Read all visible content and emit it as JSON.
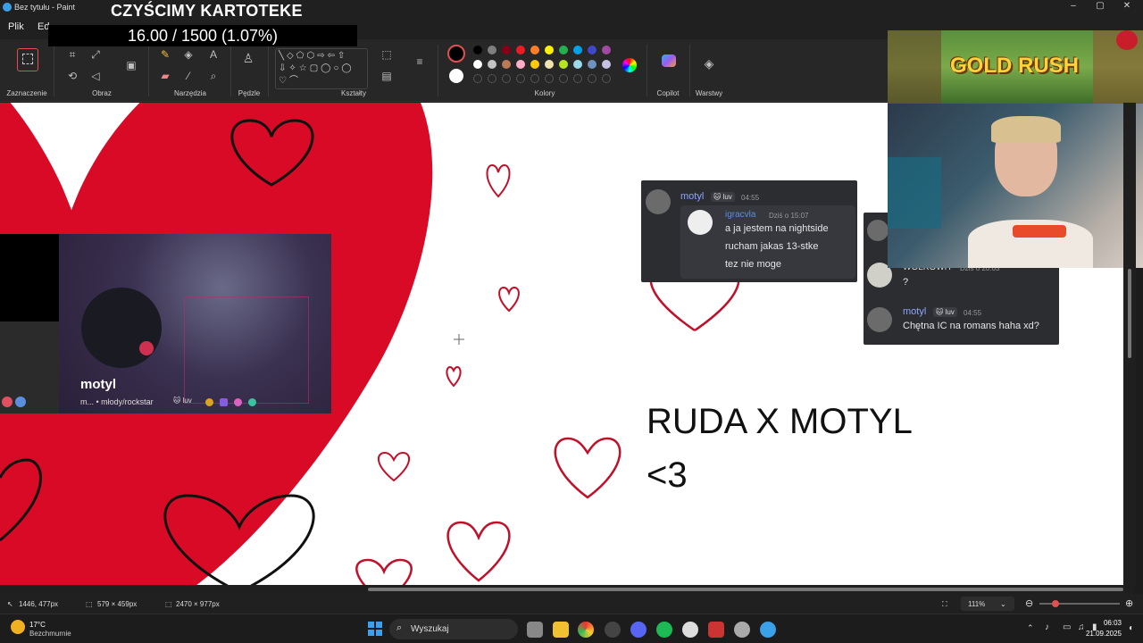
{
  "window": {
    "title": "Bez tytułu - Paint"
  },
  "stream": {
    "title": "CZYŚCIMY KARTOTEKE",
    "counter": "16.00 / 1500 (1.07%)"
  },
  "menu": {
    "file": "Plik",
    "edit": "Ed"
  },
  "ribbon": {
    "groups": {
      "selection": "Zaznaczenie",
      "image": "Obraz",
      "tools": "Narzędzia",
      "brushes": "Pędzle",
      "shapes": "Kształty",
      "colors": "Kolory",
      "copilot": "Copilot",
      "layers": "Warstwy"
    },
    "palette_row1": [
      "#000000",
      "#7f7f7f",
      "#880015",
      "#ed1c24",
      "#ff7f27",
      "#fff200",
      "#22b14c",
      "#00a2e8",
      "#3f48cc",
      "#a349a4"
    ],
    "palette_row2": [
      "#ffffff",
      "#c3c3c3",
      "#b97a57",
      "#ffaec9",
      "#ffc90e",
      "#efe4b0",
      "#b5e61d",
      "#99d9ea",
      "#7092be",
      "#c8bfe7"
    ],
    "primary_color": "#000000",
    "secondary_color": "#ffffff"
  },
  "canvas": {
    "text_line1": "RUDA X MOTYL",
    "text_line2": "<3",
    "heart_color": "#d90a25"
  },
  "chat_card_1": {
    "username": "motyl",
    "badge": "🐱 luv",
    "time": "04:55",
    "reply_user": "igracvla",
    "reply_time": "Dziś o 15:07",
    "lines": [
      "a ja jestem na nightside",
      "rucham jakas 13-stke",
      "tez nie moge"
    ]
  },
  "chat_card_2": {
    "top_user": "WOLKOWH",
    "top_time": "Dziś o 20:03",
    "top_message": "?",
    "username": "motyl",
    "badge": "🐱 luv",
    "time": "04:55",
    "message": "Chętna IC na romans haha xd?"
  },
  "tile": {
    "name": "motyl",
    "sub": "m... • młody/rockstar",
    "badge": "🐱 luv"
  },
  "game_banner": {
    "title": "GOLD RUSH"
  },
  "status": {
    "cursor_pos": "1446, 477px",
    "selection_size": "579 × 459px",
    "canvas_size": "2470 × 977px",
    "zoom": "111%"
  },
  "taskbar": {
    "weather_temp": "17°C",
    "weather_desc": "Bezchmurnie",
    "search_placeholder": "Wyszukaj",
    "time": "06:03",
    "date": "21.09.2025"
  }
}
